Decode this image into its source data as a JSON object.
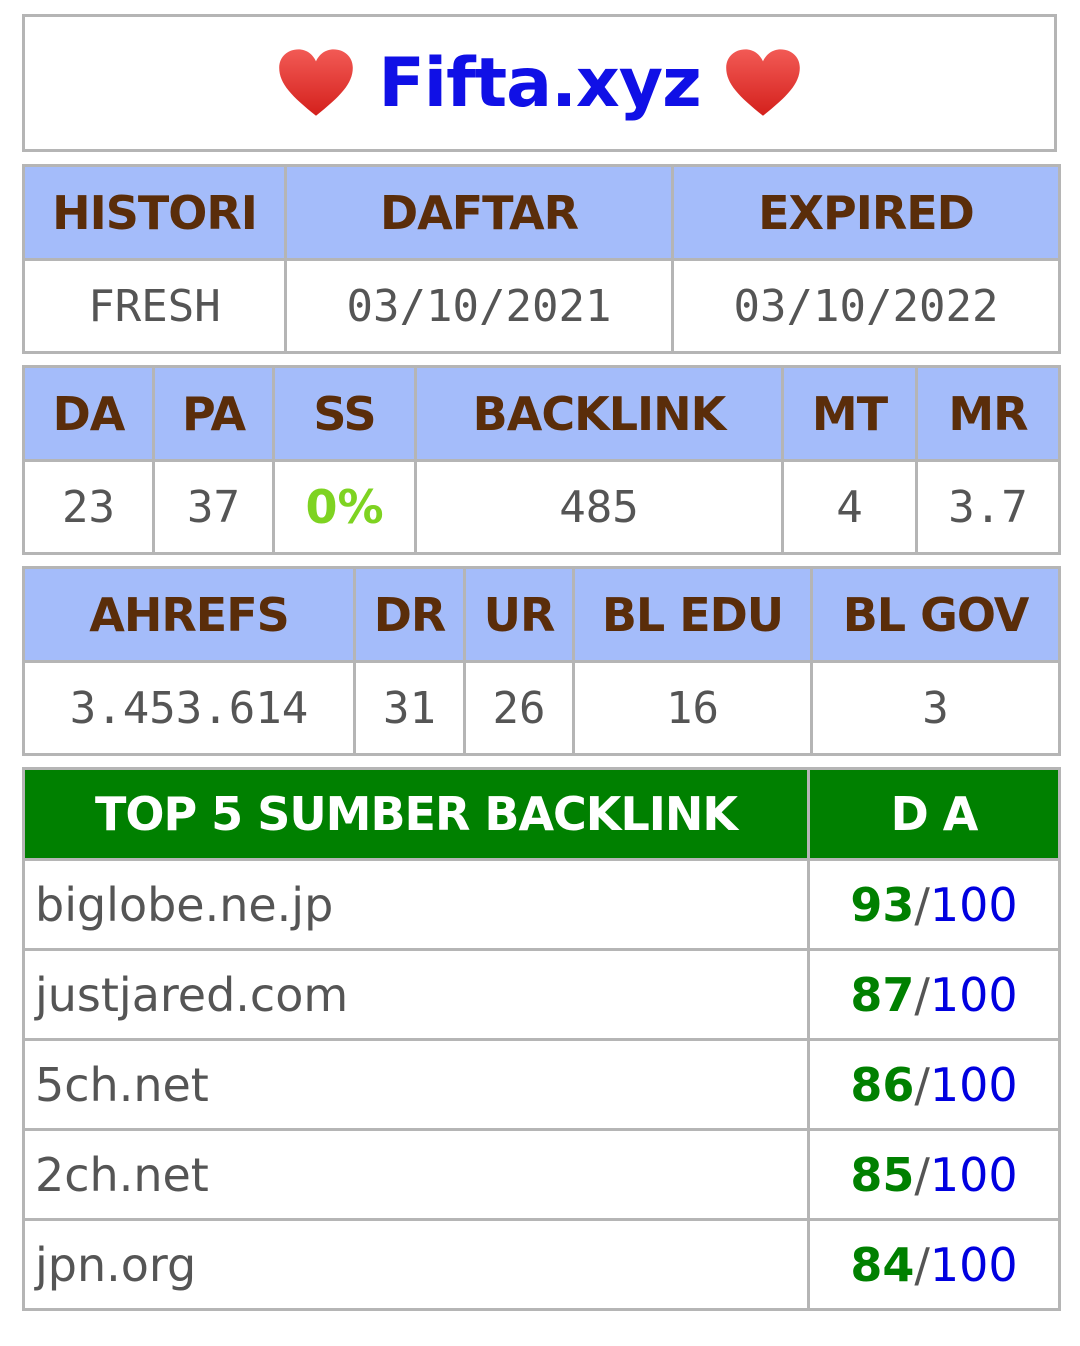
{
  "title": "Fifta.xyz",
  "colors": {
    "title": "#1010e6",
    "header_bg": "#a4bcfa",
    "header_text": "#5a2d0a",
    "top_header_bg": "#008000",
    "ss_value": "#7ed321",
    "da_value": "#008000",
    "da_max": "#0000e0",
    "heart": "#e8302c"
  },
  "icons": {
    "left": "heart-icon",
    "right": "heart-icon"
  },
  "table1": {
    "headers": [
      "HISTORI",
      "DAFTAR",
      "EXPIRED"
    ],
    "values": [
      "FRESH",
      "03/10/2021",
      "03/10/2022"
    ]
  },
  "table2": {
    "headers": [
      "DA",
      "PA",
      "SS",
      "BACKLINK",
      "MT",
      "MR"
    ],
    "values": [
      "23",
      "37",
      "0%",
      "485",
      "4",
      "3.7"
    ]
  },
  "table3": {
    "headers": [
      "AHREFS",
      "DR",
      "UR",
      "BL EDU",
      "BL GOV"
    ],
    "values": [
      "3.453.614",
      "31",
      "26",
      "16",
      "3"
    ]
  },
  "top_backlinks": {
    "header_source": "TOP 5 SUMBER BACKLINK",
    "header_da": "D A",
    "separator": "/",
    "max": "100",
    "rows": [
      {
        "domain": "biglobe.ne.jp",
        "da": "93"
      },
      {
        "domain": "justjared.com",
        "da": "87"
      },
      {
        "domain": "5ch.net",
        "da": "86"
      },
      {
        "domain": "2ch.net",
        "da": "85"
      },
      {
        "domain": "jpn.org",
        "da": "84"
      }
    ]
  }
}
